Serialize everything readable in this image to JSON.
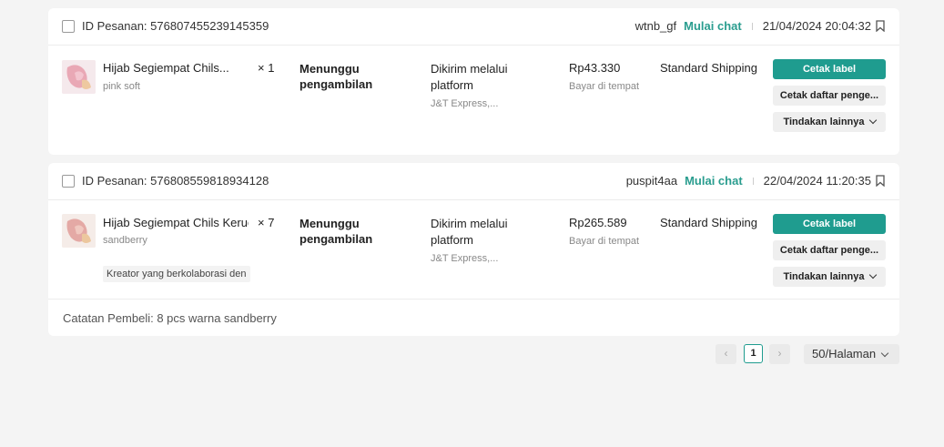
{
  "orders": [
    {
      "order_id": "ID Pesanan: 576807455239145359",
      "username": "wtnb_gf",
      "chat_label": "Mulai chat",
      "date": "21/04/2024 20:04:32",
      "product_name": "Hijab Segiempat Chils...",
      "variation": "pink soft",
      "quantity": "× 1",
      "status": "Menunggu pengambilan",
      "shipping": "Dikirim melalui platform",
      "courier": "J&T Express,...",
      "price": "Rp43.330",
      "payment": "Bayar di tempat",
      "shipping_method": "Standard Shipping",
      "btn_print_label": "Cetak label",
      "btn_print_list": "Cetak daftar penge...",
      "btn_more": "Tindakan lainnya"
    },
    {
      "order_id": "ID Pesanan: 576808559818934128",
      "username": "puspit4aa",
      "chat_label": "Mulai chat",
      "date": "22/04/2024 11:20:35",
      "product_name": "Hijab Segiempat Chils Keruc",
      "variation": "sandberry",
      "quantity": "× 7",
      "creator_tag": "Kreator yang berkolaborasi den",
      "status": "Menunggu pengambilan",
      "shipping": "Dikirim melalui platform",
      "courier": "J&T Express,...",
      "price": "Rp265.589",
      "payment": "Bayar di tempat",
      "shipping_method": "Standard Shipping",
      "btn_print_label": "Cetak label",
      "btn_print_list": "Cetak daftar penge...",
      "btn_more": "Tindakan lainnya",
      "buyer_note": "Catatan Pembeli: 8 pcs warna sandberry"
    }
  ],
  "pagination": {
    "prev": "‹",
    "current_page": "1",
    "next": "›",
    "per_page": "50/Halaman"
  },
  "colors": {
    "accent": "#1f9c8f",
    "background": "#f4f4f4"
  }
}
